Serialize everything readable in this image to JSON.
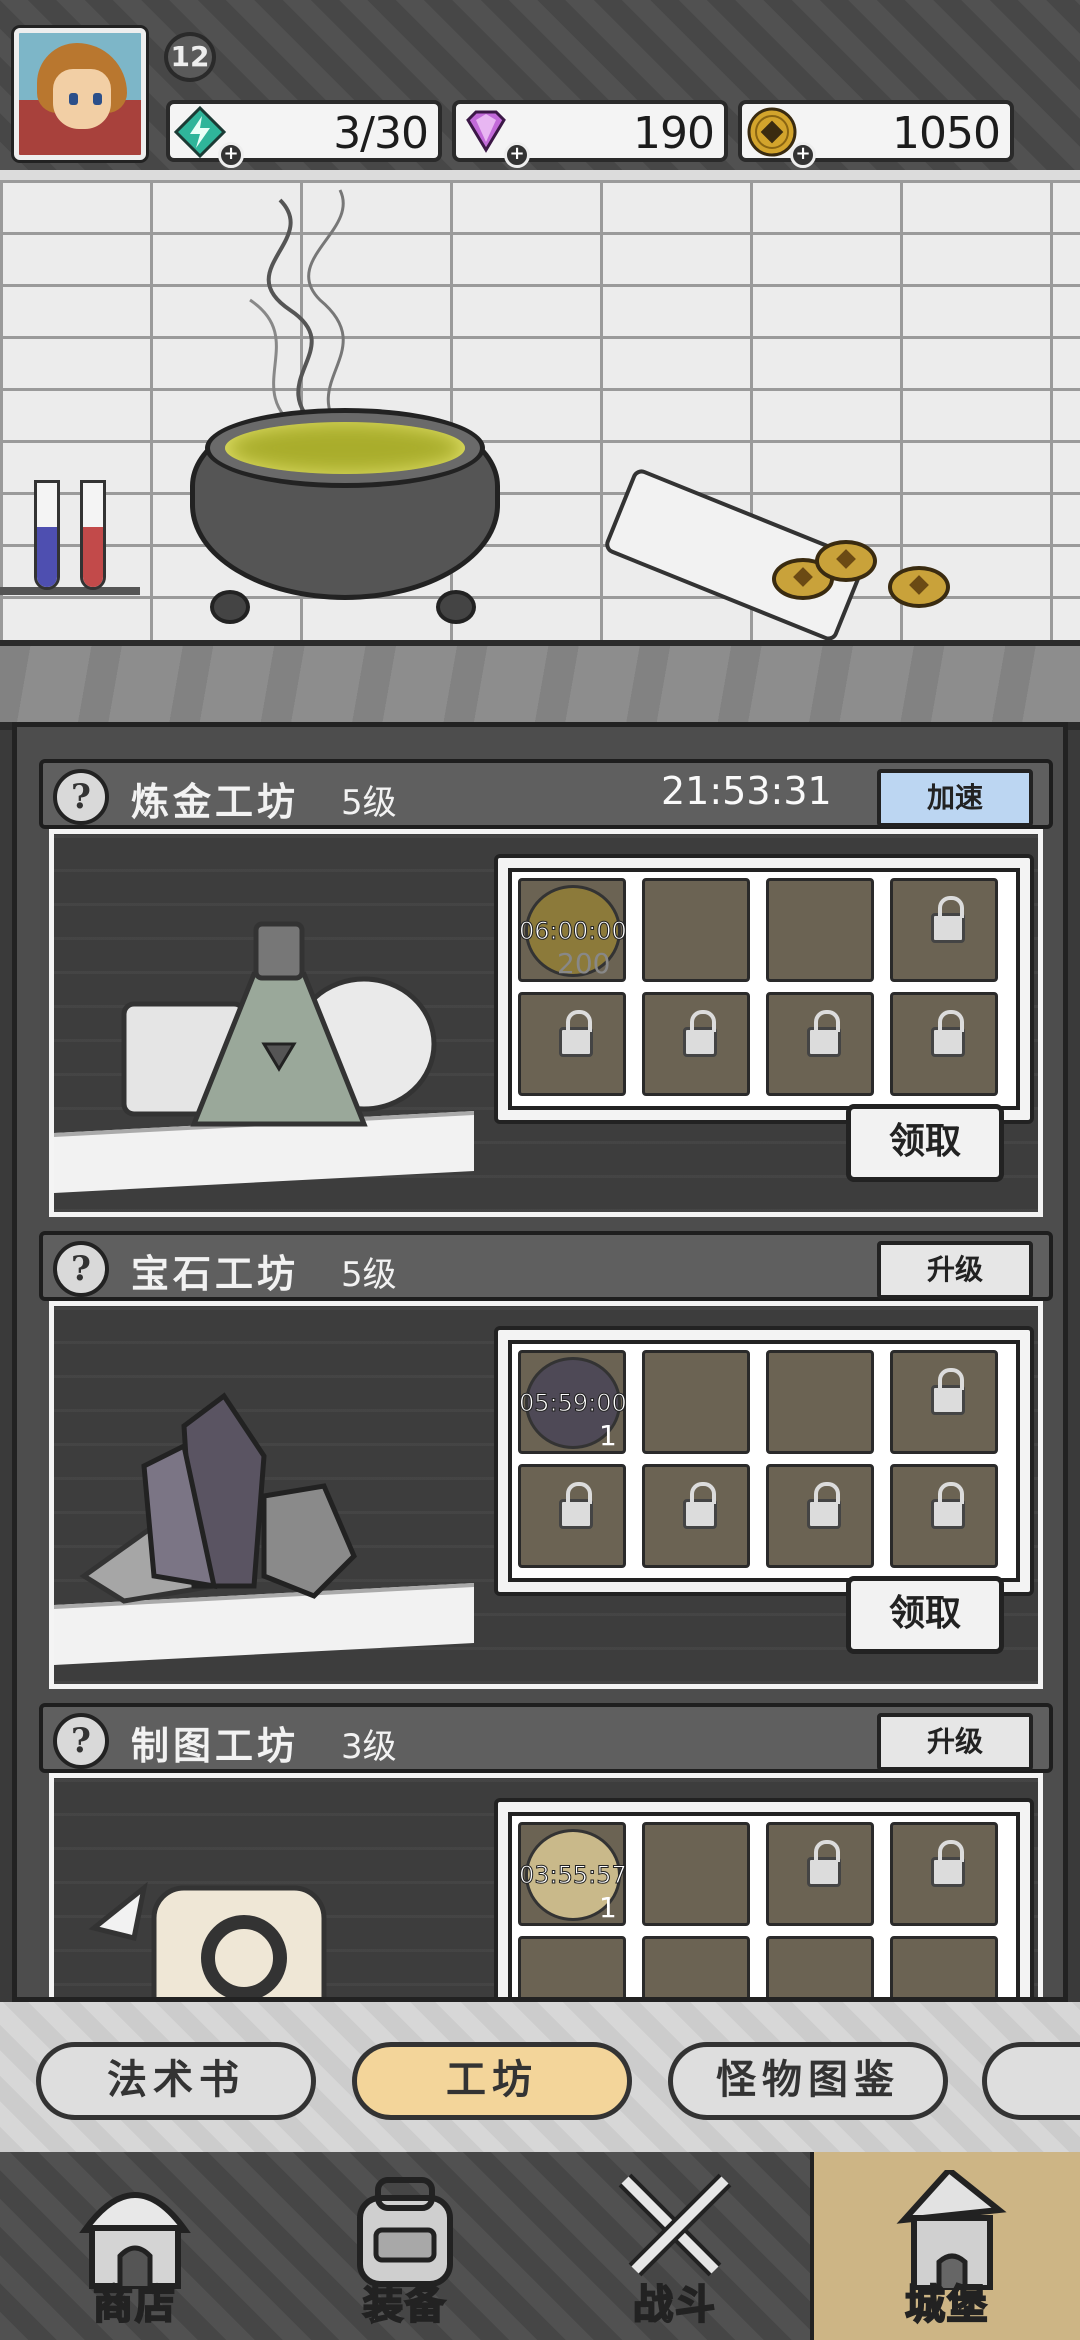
{
  "player": {
    "level": "12"
  },
  "resources": [
    {
      "name": "energy",
      "value": "3/30",
      "icon": "lightning-gem-icon",
      "color": "#2fb59a"
    },
    {
      "name": "gems",
      "value": "190",
      "icon": "diamond-icon",
      "color": "#c26ad9"
    },
    {
      "name": "gold",
      "value": "1050",
      "icon": "gold-coin-icon",
      "color": "#d3a42c"
    }
  ],
  "workshops": [
    {
      "title": "炼金工坊",
      "level": "5级",
      "timer": "21:53:31",
      "header_button": "加速",
      "slots": [
        {
          "timer": "06:00:00",
          "amount": "200"
        }
      ],
      "claim": "领取"
    },
    {
      "title": "宝石工坊",
      "level": "5级",
      "header_button": "升级",
      "slots": [
        {
          "timer": "05:59:00",
          "amount": "1"
        }
      ],
      "claim": "领取"
    },
    {
      "title": "制图工坊",
      "level": "3级",
      "header_button": "升级",
      "slots": [
        {
          "timer": "03:55:57",
          "amount": "1"
        }
      ]
    }
  ],
  "tabs": [
    {
      "label": "法术书",
      "active": false
    },
    {
      "label": "工坊",
      "active": true
    },
    {
      "label": "怪物图鉴",
      "active": false
    }
  ],
  "nav": [
    {
      "label": "商店",
      "icon": "shop-icon"
    },
    {
      "label": "装备",
      "icon": "backpack-icon"
    },
    {
      "label": "战斗",
      "icon": "crossed-swords-icon"
    },
    {
      "label": "城堡",
      "icon": "castle-icon",
      "active": true
    }
  ]
}
